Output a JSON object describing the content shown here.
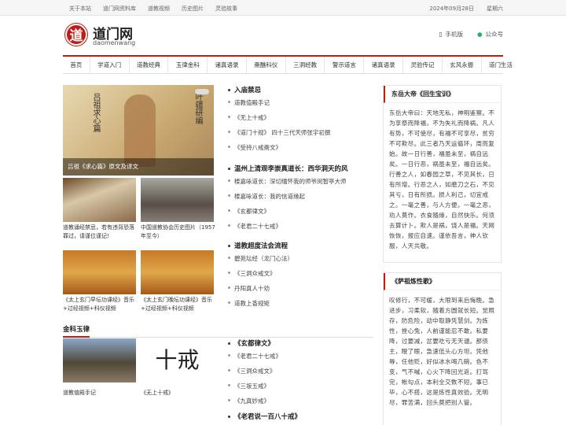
{
  "topbar": {
    "links": [
      "关于本站",
      "道门网资料库",
      "道教视频",
      "历史图片",
      "灵验故事"
    ],
    "date": "2024年09月28日",
    "weekday": "星期六"
  },
  "header": {
    "logo_char": "道",
    "site_name": "道门网",
    "site_en": "daomenwang",
    "mobile": "手机版",
    "wechat": "公众号"
  },
  "nav": [
    "首页",
    "学道入门",
    "道教经典",
    "玉律金科",
    "诸真语录",
    "斋醮科仪",
    "三洞经教",
    "警示道言",
    "诸真语录",
    "灵验传记",
    "玄风永振",
    "道门生活"
  ],
  "hero": {
    "caption": "吕祖《求心篇》原文及译文",
    "cal_left": "吕祖求心篇",
    "cal_right": "叶疆研编"
  },
  "list1": {
    "title": "入庙禁忌",
    "items": [
      "道教值殿手记",
      "《无上十戒》",
      "《道门十规》 四十三代天师张宇初撰",
      "《受持八戒斋文》"
    ]
  },
  "list2": {
    "title": "温州上清观李崇真道长：西华洞天的风",
    "items": [
      "楼嘉咏道长：深切缅怀我的师爷闵智亭大师",
      "楼嘉咏道长：我的信道缘起",
      "《玄都律文》",
      "《老君二十七戒》"
    ]
  },
  "list3": {
    "title": "道教超度法会流程",
    "items": [
      "碧苑坛经（龙门心法）",
      "《三洞众戒文》",
      "丹阳真人十劝",
      "道教上香规矩"
    ]
  },
  "thumbs": [
    {
      "caption": "道教诵经禁忌，若有违背恐落罪过，请谨位谨记!"
    },
    {
      "caption": "中国道教协会历史图片（1957年至今）"
    },
    {
      "caption": "《太上玄门早坛功课经》音乐+过经视频+科仪视频"
    },
    {
      "caption": "《太上玄门晚坛功课经》音乐+过经视频+科仪视频"
    }
  ],
  "section2": {
    "title": "金科玉律",
    "thumbs": [
      {
        "caption": "道教值殿手记"
      },
      {
        "caption": "《无上十戒》",
        "big_text": "十戒"
      }
    ],
    "items": [
      "《玄都律文》",
      "《老君二十七戒》",
      "《三洞众戒文》",
      "《三坂五戒》",
      "《九真妙戒》",
      "《老君说一百八十戒》"
    ]
  },
  "side1": {
    "title": "东岳大帝《回生宝训》",
    "content": "东岳大帝曰：天地无私，神明鉴察。不为享祭而降福，不为失礼而降祸。凡人有势，不可使尽，有福不可享尽，贫穷不可欺尽。此三者乃天运循环，周而复始。故一日行善，福虽未至，祸自远矣。一日行恶，祸虽未至，福自远矣。行善之人，如春园之草，不见其长，日有所增。行恶之人，如磨刀之石，不见其亏，日有所损。损人利己，切宜戒之。一毫之善，与人方便。一毫之恶，劝人莫作。衣食随缘，自然快乐。何须去算计卜。欺人是祸，饶人是福。天网恢恢，报应自速。谨依吾言，神人钦服，人天共敬。"
  },
  "side2": {
    "title": "《萨祖炼性歌》",
    "content": "叹修行，不可缓，大限到来后悔晚。急进步，习柔软，随着方圆就长短。觉照存，防危险，动中取静凭慧剑。为炼性，挫心兔，人前谨能忍不敢。私要降，过要减，忿要吃亏无天谴。那债主，瞪了眼，急速低头心方坦。凭他辱，任他贬，好似冰水喝几碗。色不变，气不喊，心火下降回光返。打骂完，帐勾点，本利全交数不短。事已毕，心不搭，这是炼性真效验。无明尽，罪苦满，回头莫把别人管。"
  }
}
